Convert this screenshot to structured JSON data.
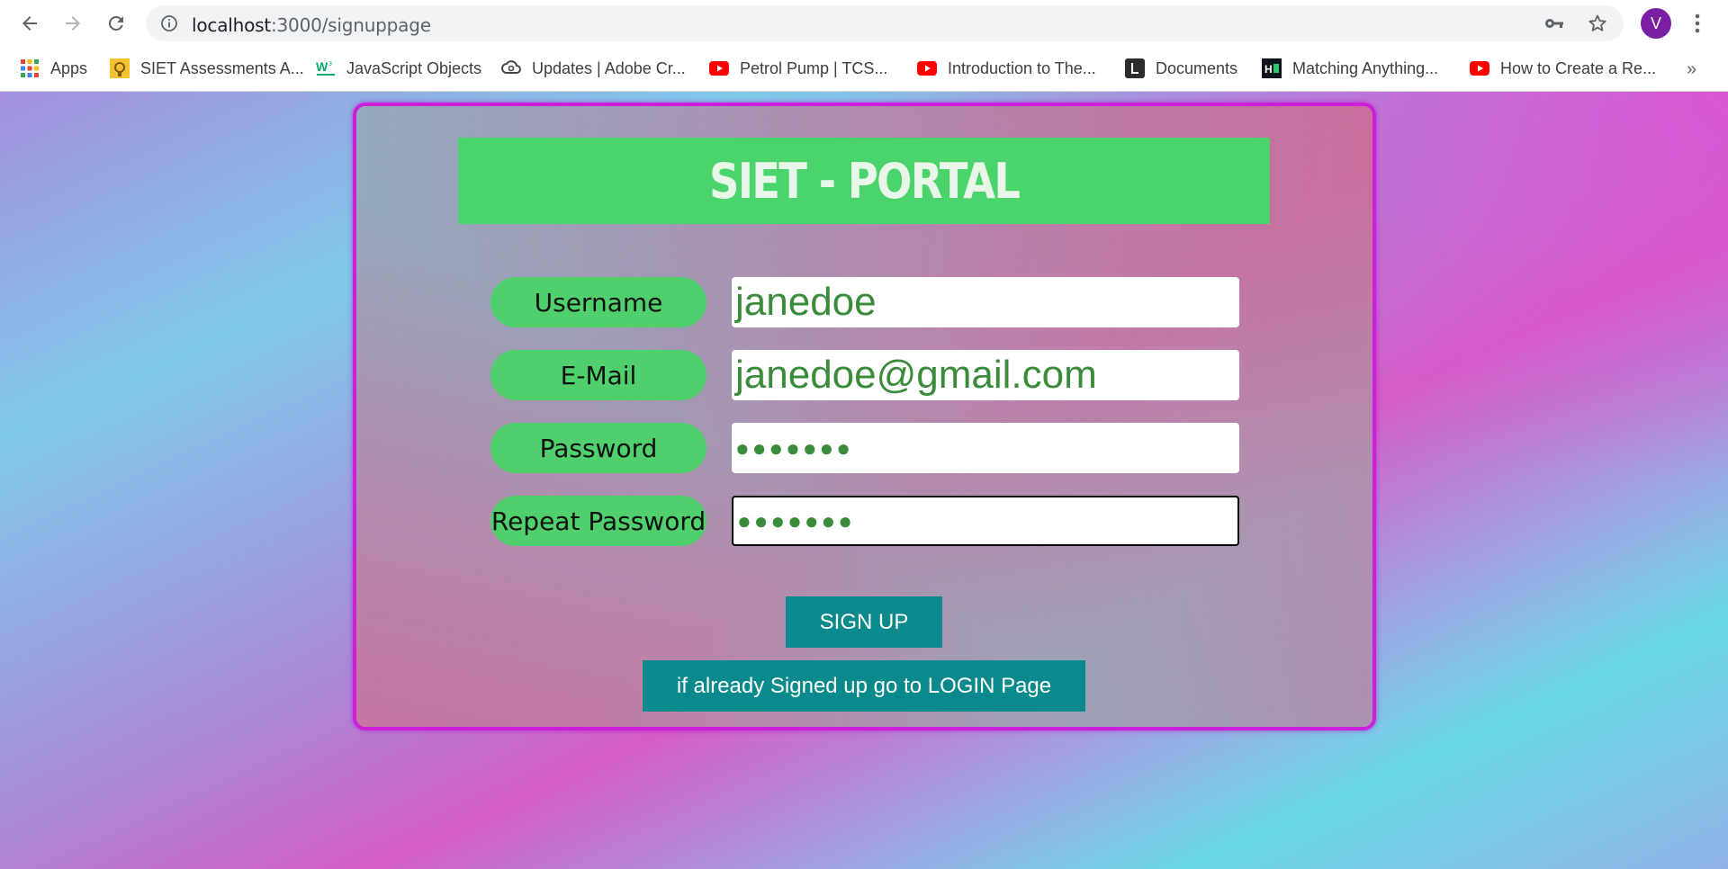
{
  "browser": {
    "url_host": "localhost",
    "url_path": ":3000/signuppage",
    "profile_initial": "V",
    "bookmarks": [
      {
        "label": "Apps",
        "icon": "apps-grid-icon"
      },
      {
        "label": "SIET Assessments A...",
        "icon": "siet-favicon"
      },
      {
        "label": "JavaScript Objects",
        "icon": "w3schools-favicon"
      },
      {
        "label": "Updates | Adobe Cr...",
        "icon": "adobe-cc-favicon"
      },
      {
        "label": "Petrol Pump | TCS...",
        "icon": "youtube-favicon"
      },
      {
        "label": "Introduction to The...",
        "icon": "youtube-favicon"
      },
      {
        "label": "Documents",
        "icon": "document-favicon"
      },
      {
        "label": "Matching Anything...",
        "icon": "hackerrank-favicon"
      },
      {
        "label": "How to Create a Re...",
        "icon": "youtube-favicon"
      }
    ],
    "more_glyph": "»"
  },
  "form": {
    "title": "SIET - PORTAL",
    "fields": [
      {
        "label": "Username",
        "value": "janedoe"
      },
      {
        "label": "E-Mail",
        "value": "janedoe@gmail.com"
      },
      {
        "label": "Password",
        "value": "●●●●●●●"
      },
      {
        "label": "Repeat Password",
        "value": "●●●●●●●"
      }
    ],
    "signup_button": "SIGN UP",
    "login_button": "if already Signed up go to LOGIN Page"
  },
  "colors": {
    "accent_green": "#4cd46c",
    "button_teal": "#0b8a8d",
    "card_border": "#cc1fd9",
    "input_text": "#3a8b3a"
  }
}
